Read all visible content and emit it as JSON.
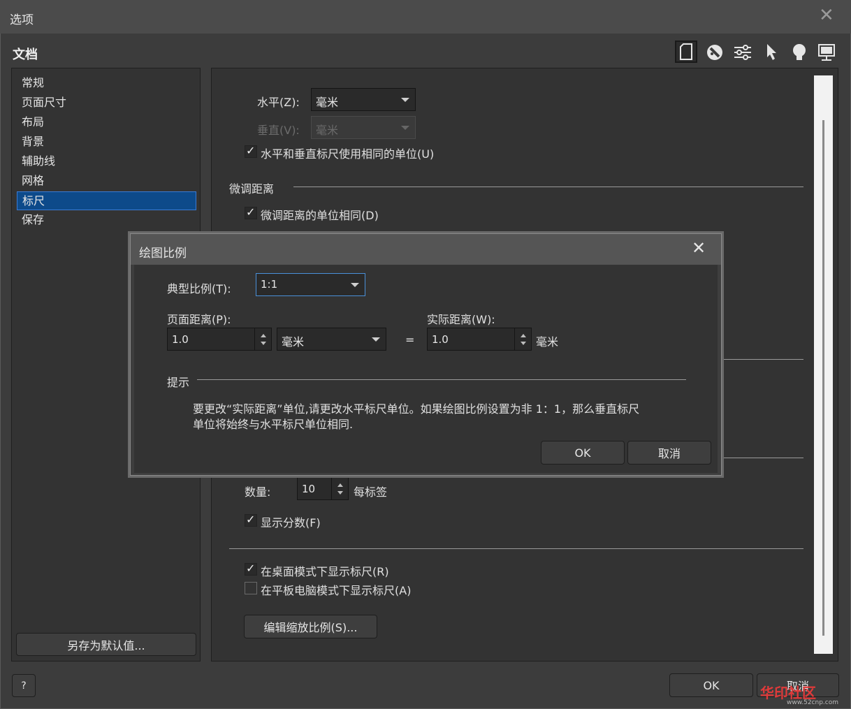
{
  "window": {
    "title": "选项"
  },
  "section_title": "文档",
  "toolbar": {
    "icons": [
      "document-icon",
      "color-icon",
      "sliders-icon",
      "pointer-icon",
      "bulb-icon",
      "display-icon"
    ]
  },
  "nav": {
    "items": [
      {
        "label": "常规"
      },
      {
        "label": "页面尺寸"
      },
      {
        "label": "布局"
      },
      {
        "label": "背景"
      },
      {
        "label": "辅助线"
      },
      {
        "label": "网格"
      },
      {
        "label": "标尺",
        "selected": true
      },
      {
        "label": "保存"
      }
    ],
    "save_default_label": "另存为默认值..."
  },
  "content": {
    "horizontal_label": "水平(Z):",
    "horizontal_value": "毫米",
    "vertical_label": "垂直(V):",
    "vertical_value": "毫米",
    "same_units_label": "水平和垂直标尺使用相同的单位(U)",
    "same_units_checked": true,
    "nudge_heading": "微调距离",
    "nudge_same_label": "微调距离的单位相同(D)",
    "nudge_same_checked": true,
    "count_label": "数量:",
    "count_value": "10",
    "per_tick_label": "每标签",
    "show_fraction_label": "显示分数(F)",
    "show_fraction_checked": true,
    "desktop_mode_label": "在桌面模式下显示标尺(R)",
    "desktop_mode_checked": true,
    "tablet_mode_label": "在平板电脑模式下显示标尺(A)",
    "tablet_mode_checked": false,
    "edit_scale_label": "编辑缩放比例(S)..."
  },
  "footer": {
    "help_label": "?",
    "ok_label": "OK",
    "cancel_label": "取消"
  },
  "modal": {
    "title": "绘图比例",
    "typical_scale_label": "典型比例(T):",
    "typical_scale_value": "1:1",
    "page_distance_label": "页面距离(P):",
    "page_distance_value": "1.0",
    "page_distance_unit": "毫米",
    "equals": "=",
    "actual_distance_label": "实际距离(W):",
    "actual_distance_value": "1.0",
    "actual_distance_unit": "毫米",
    "hint_heading": "提示",
    "hint_text_line1": "要更改“实际距离”单位,请更改水平标尺单位。如果绘图比例设置为非 1：1，那么垂直标尺",
    "hint_text_line2": "单位将始终与水平标尺单位相同.",
    "ok_label": "OK",
    "cancel_label": "取消"
  },
  "watermark": {
    "text": "华印社区",
    "url": "www.52cnp.com"
  },
  "colors": {
    "selection": "#0d4a8a",
    "focus": "#4a90d9",
    "background": "#3c3c3c"
  }
}
